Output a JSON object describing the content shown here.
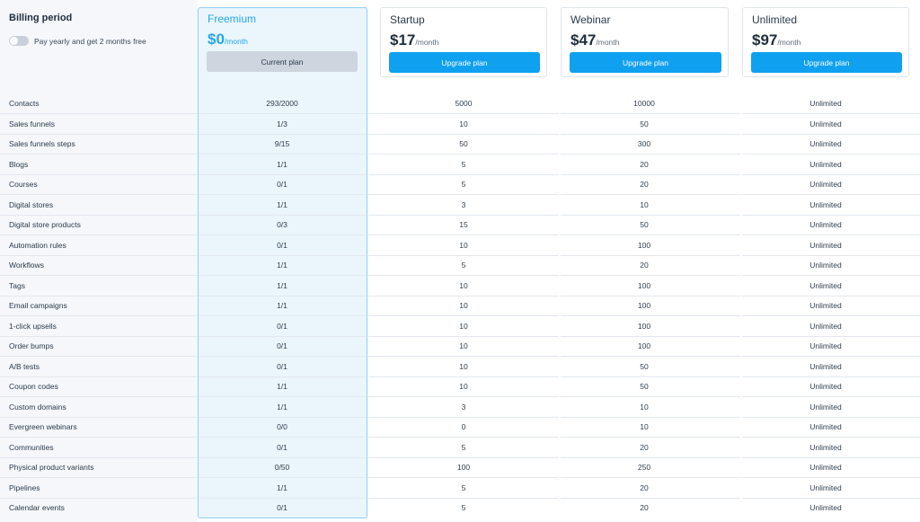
{
  "billing": {
    "title": "Billing period",
    "toggle_label": "Pay yearly and get 2 months free"
  },
  "plans": [
    {
      "name": "Freemium",
      "price": "$0",
      "period": "/month",
      "button": "Current plan",
      "current": true
    },
    {
      "name": "Startup",
      "price": "$17",
      "period": "/month",
      "button": "Upgrade plan",
      "current": false
    },
    {
      "name": "Webinar",
      "price": "$47",
      "period": "/month",
      "button": "Upgrade plan",
      "current": false
    },
    {
      "name": "Unlimited",
      "price": "$97",
      "period": "/month",
      "button": "Upgrade plan",
      "current": false
    }
  ],
  "colors": {
    "accent": "#0fa0f0",
    "current_highlight": "#26a7e8",
    "current_column_bg": "#eaf5fc",
    "current_column_border": "#8fd0f3"
  },
  "features": [
    {
      "label": "Contacts",
      "values": [
        "293/2000",
        "5000",
        "10000",
        "Unlimited"
      ]
    },
    {
      "label": "Sales funnels",
      "values": [
        "1/3",
        "10",
        "50",
        "Unlimited"
      ]
    },
    {
      "label": "Sales funnels steps",
      "values": [
        "9/15",
        "50",
        "300",
        "Unlimited"
      ]
    },
    {
      "label": "Blogs",
      "values": [
        "1/1",
        "5",
        "20",
        "Unlimited"
      ]
    },
    {
      "label": "Courses",
      "values": [
        "0/1",
        "5",
        "20",
        "Unlimited"
      ]
    },
    {
      "label": "Digital stores",
      "values": [
        "1/1",
        "3",
        "10",
        "Unlimited"
      ]
    },
    {
      "label": "Digital store products",
      "values": [
        "0/3",
        "15",
        "50",
        "Unlimited"
      ]
    },
    {
      "label": "Automation rules",
      "values": [
        "0/1",
        "10",
        "100",
        "Unlimited"
      ]
    },
    {
      "label": "Workflows",
      "values": [
        "1/1",
        "5",
        "20",
        "Unlimited"
      ]
    },
    {
      "label": "Tags",
      "values": [
        "1/1",
        "10",
        "100",
        "Unlimited"
      ]
    },
    {
      "label": "Email campaigns",
      "values": [
        "1/1",
        "10",
        "100",
        "Unlimited"
      ]
    },
    {
      "label": "1-click upsells",
      "values": [
        "0/1",
        "10",
        "100",
        "Unlimited"
      ]
    },
    {
      "label": "Order bumps",
      "values": [
        "0/1",
        "10",
        "100",
        "Unlimited"
      ]
    },
    {
      "label": "A/B tests",
      "values": [
        "0/1",
        "10",
        "50",
        "Unlimited"
      ]
    },
    {
      "label": "Coupon codes",
      "values": [
        "1/1",
        "10",
        "50",
        "Unlimited"
      ]
    },
    {
      "label": "Custom domains",
      "values": [
        "1/1",
        "3",
        "10",
        "Unlimited"
      ]
    },
    {
      "label": "Evergreen webinars",
      "values": [
        "0/0",
        "0",
        "10",
        "Unlimited"
      ]
    },
    {
      "label": "Communities",
      "values": [
        "0/1",
        "5",
        "20",
        "Unlimited"
      ]
    },
    {
      "label": "Physical product variants",
      "values": [
        "0/50",
        "100",
        "250",
        "Unlimited"
      ]
    },
    {
      "label": "Pipelines",
      "values": [
        "1/1",
        "5",
        "20",
        "Unlimited"
      ]
    },
    {
      "label": "Calendar events",
      "values": [
        "0/1",
        "5",
        "20",
        "Unlimited"
      ]
    }
  ]
}
